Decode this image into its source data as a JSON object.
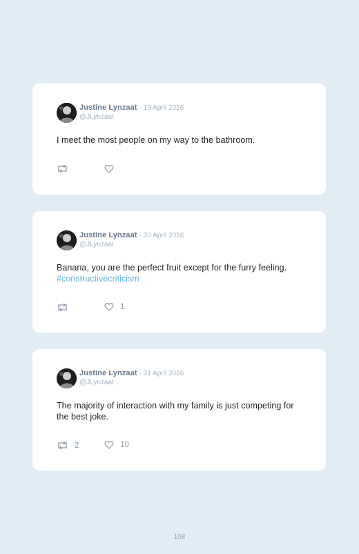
{
  "tweets": [
    {
      "author": "Justine Lynzaat",
      "date": "· 19 April 2016",
      "handle": "@JLynzaat",
      "text": "I meet the most people on my way to the bathroom.",
      "hashtag": "",
      "retweets": "",
      "likes": ""
    },
    {
      "author": "Justine Lynzaat",
      "date": "· 20 April 2016",
      "handle": "@JLynzaat",
      "text": "Banana, you are the perfect fruit except for the furry feeling.",
      "hashtag": "#constructivecriticism",
      "retweets": "",
      "likes": "1"
    },
    {
      "author": "Justine Lynzaat",
      "date": "· 21 April 2016",
      "handle": "@JLynzaat",
      "text": "The majority of interaction with my family is just competing for the best joke.",
      "hashtag": "",
      "retweets": "2",
      "likes": "10"
    }
  ],
  "icons": {
    "retweet": "retweet-icon",
    "like": "heart-icon"
  },
  "page_number": "108",
  "colors": {
    "background": "#e1edf5",
    "card": "#ffffff",
    "hashtag": "#5bb3e0",
    "name": "#67788a"
  }
}
